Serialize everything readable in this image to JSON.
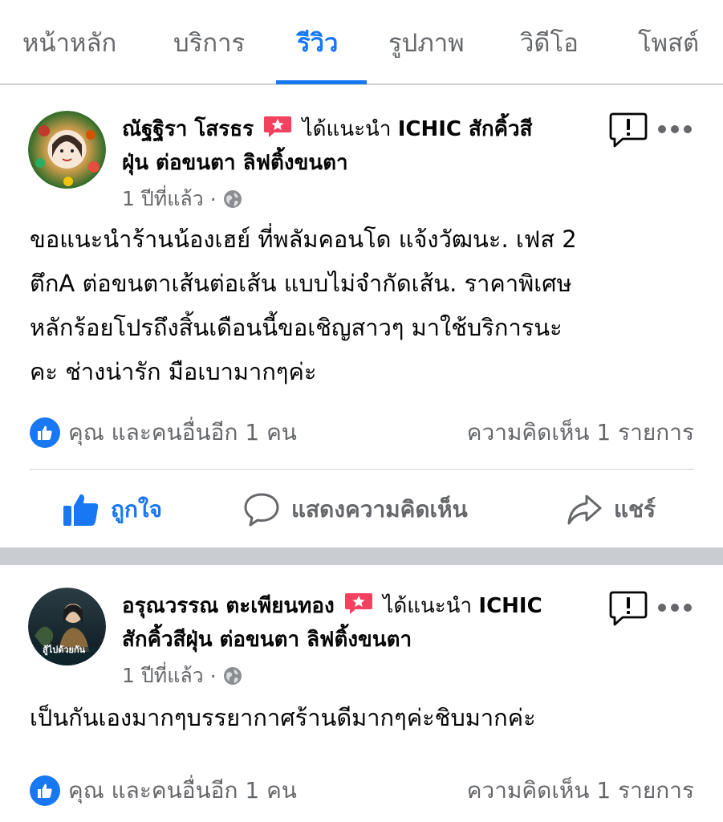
{
  "tabs": [
    {
      "label": "หน้าหลัก",
      "active": false
    },
    {
      "label": "บริการ",
      "active": false
    },
    {
      "label": "รีวิว",
      "active": true
    },
    {
      "label": "รูปภาพ",
      "active": false
    },
    {
      "label": "วิดีโอ",
      "active": false
    },
    {
      "label": "โพสต์",
      "active": false
    }
  ],
  "colors": {
    "accent": "#1877f2",
    "recommend": "#f3425f",
    "muted": "#65676b"
  },
  "posts": [
    {
      "author": "ณัฐฐิรา โสรธร",
      "recommend_text": "ได้แนะนำ",
      "page": "ICHIC สักคิ้วสี",
      "page_cont": "ฝุ่น ต่อขนตา ลิฟติ้งขนตา",
      "time": "1 ปีที่แล้ว",
      "dot": "·",
      "body": [
        "ขอแนะนำร้านน้องเฮย์ ที่พลัมคอนโด แจ้งวัฒนะ. เฟส 2",
        "ตึกA ต่อขนตาเส้นต่อเส้น แบบไม่จำกัดเส้น. ราคาพิเศษ",
        "หลักร้อยโปรถึงสิ้นเดือนนี้ขอเชิญสาวๆ มาใช้บริการนะ",
        "คะ ช่างน่ารัก มือเบามากๆค่ะ"
      ],
      "reactions_text": "คุณ และคนอื่นอีก 1 คน",
      "comments_text": "ความคิดเห็น 1 รายการ"
    },
    {
      "author": "อรุณวรรณ ตะเพียนทอง",
      "recommend_text": "ได้แนะนำ",
      "page": "ICHIC",
      "page_cont": "สักคิ้วสีฝุ่น ต่อขนตา ลิฟติ้งขนตา",
      "time": "1 ปีที่แล้ว",
      "dot": "·",
      "body": [
        "เป็นกันเองมากๆบรรยากาศร้านดีมากๆค่ะชิบมากค่ะ"
      ],
      "reactions_text": "คุณ และคนอื่นอีก 1 คน",
      "comments_text": "ความคิดเห็น 1 รายการ",
      "avatar_caption": "สู้ไปด้วยกัน"
    }
  ],
  "actions": {
    "like": "ถูกใจ",
    "comment": "แสดงความคิดเห็น",
    "share": "แชร์"
  },
  "icons": {
    "like": "thumbs-up-icon",
    "comment": "comment-bubble-icon",
    "share": "share-arrow-icon",
    "report": "report-flag-icon",
    "more": "more-dots-icon",
    "privacy": "globe-icon",
    "recommend": "recommend-star-icon"
  }
}
